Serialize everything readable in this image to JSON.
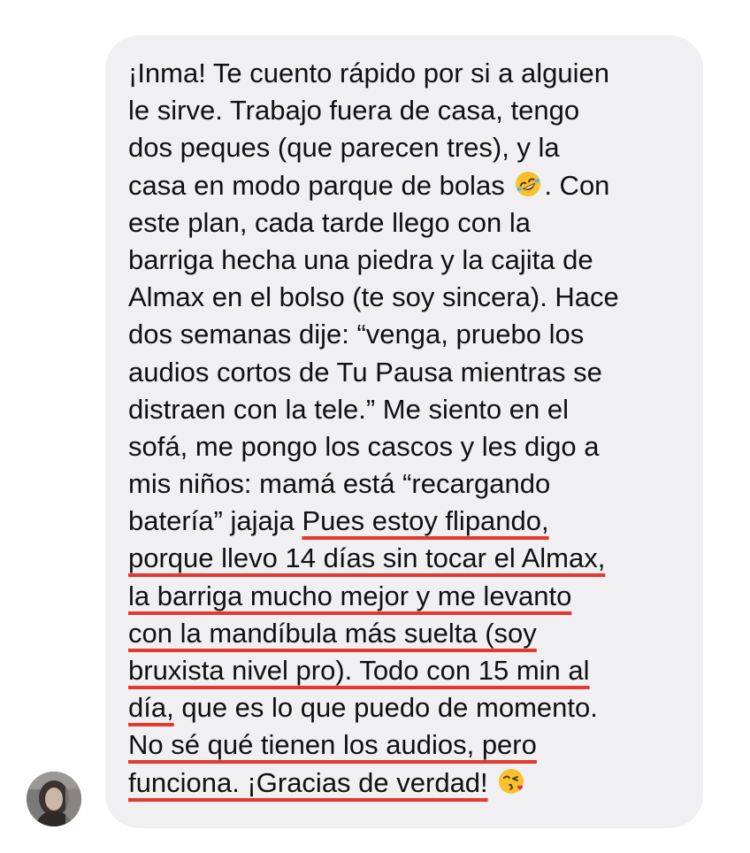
{
  "message": {
    "lines": [
      [
        {
          "t": "¡Inma! Te cuento rápido por si a alguien",
          "u": false
        }
      ],
      [
        {
          "t": "le sirve. Trabajo fuera de casa, tengo",
          "u": false
        }
      ],
      [
        {
          "t": "dos peques (que parecen tres), y la",
          "u": false
        }
      ],
      [
        {
          "t": "casa en modo parque de bolas",
          "u": false
        },
        {
          "t": ". Con",
          "u": false
        }
      ],
      [
        {
          "t": "este plan, cada tarde llego con la",
          "u": false
        }
      ],
      [
        {
          "t": "barriga hecha una piedra y la cajita de",
          "u": false
        }
      ],
      [
        {
          "t": "Almax en el bolso (te soy sincera). Hace",
          "u": false
        }
      ],
      [
        {
          "t": "dos semanas dije: “venga, pruebo los",
          "u": false
        }
      ],
      [
        {
          "t": "audios cortos de Tu Pausa mientras se",
          "u": false
        }
      ],
      [
        {
          "t": "distraen con la tele.” Me siento en el",
          "u": false
        }
      ],
      [
        {
          "t": "sofá, me pongo los cascos y les digo a",
          "u": false
        }
      ],
      [
        {
          "t": "mis niños: mamá está “recargando",
          "u": false
        }
      ],
      [
        {
          "t": "batería” jajaja ",
          "u": false
        },
        {
          "t": "Pues estoy flipando,",
          "u": true
        }
      ],
      [
        {
          "t": "porque llevo 14 días sin tocar el Almax,",
          "u": true
        }
      ],
      [
        {
          "t": "la barriga mucho mejor y me levanto",
          "u": true
        }
      ],
      [
        {
          "t": "con la mandíbula más suelta (soy",
          "u": true
        }
      ],
      [
        {
          "t": "bruxista nivel pro). Todo con 15 min al",
          "u": true
        }
      ],
      [
        {
          "t": "día,",
          "u": true
        },
        {
          "t": " que es lo que puedo de momento.",
          "u": false
        }
      ],
      [
        {
          "t": "No sé qué tienen los audios, pero",
          "u": true
        }
      ],
      [
        {
          "t": "funciona. ¡Gracias de verdad!",
          "u": true
        }
      ]
    ],
    "emoji_laughing": "rolling-on-floor-laughing-emoji",
    "emoji_kiss": "face-blowing-kiss-emoji"
  },
  "colors": {
    "bubble": "#f0f0f2",
    "text": "#111111",
    "underline": "#e5382e"
  },
  "avatar": {
    "icon": "user-avatar-photo"
  }
}
